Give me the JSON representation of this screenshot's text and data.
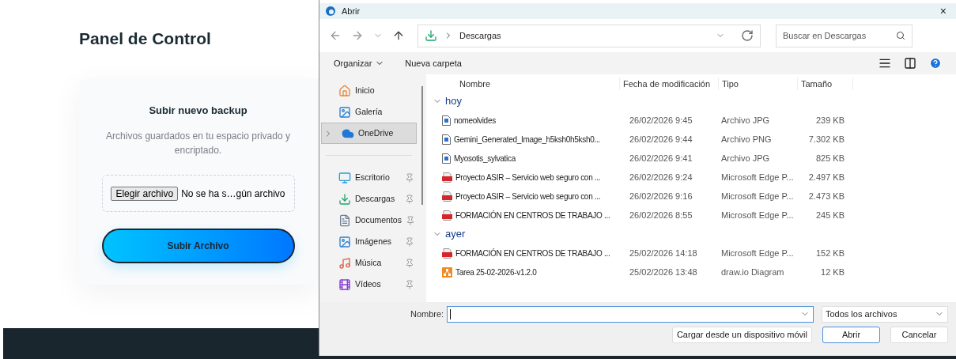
{
  "page": {
    "title": "Panel de Control",
    "card": {
      "heading": "Subir nuevo backup",
      "description": "Archivos guardados en tu espacio privado y encriptado.",
      "file_button": "Elegir archivo",
      "file_status": "No se ha s…gún archivo",
      "upload_button": "Subir Archivo"
    }
  },
  "dialog": {
    "title": "Abrir",
    "close": "×",
    "location": "Descargas",
    "search_placeholder": "Buscar en Descargas",
    "toolbar": {
      "organize": "Organizar",
      "new_folder": "Nueva carpeta"
    },
    "sidebar": [
      {
        "label": "Inicio",
        "kind": "home",
        "pinned": false,
        "selected": false
      },
      {
        "label": "Galería",
        "kind": "gallery",
        "pinned": false,
        "selected": false
      },
      {
        "label": "OneDrive",
        "kind": "cloud",
        "pinned": false,
        "selected": true
      },
      {
        "label": "Escritorio",
        "kind": "desktop",
        "pinned": true,
        "selected": false
      },
      {
        "label": "Descargas",
        "kind": "download",
        "pinned": true,
        "selected": false
      },
      {
        "label": "Documentos",
        "kind": "documents",
        "pinned": true,
        "selected": false
      },
      {
        "label": "Imágenes",
        "kind": "pictures",
        "pinned": true,
        "selected": false
      },
      {
        "label": "Música",
        "kind": "music",
        "pinned": true,
        "selected": false
      },
      {
        "label": "Vídeos",
        "kind": "videos",
        "pinned": true,
        "selected": false
      }
    ],
    "columns": [
      "Nombre",
      "Fecha de modificación",
      "Tipo",
      "Tamaño"
    ],
    "groups": [
      {
        "label": "hoy",
        "expanded": true,
        "files": [
          {
            "name": "nomeolvides",
            "date": "26/02/2026 9:45",
            "type": "Archivo JPG",
            "size": "239 KB",
            "kind": "image"
          },
          {
            "name": "Gemini_Generated_Image_h5ksh0h5ksh0...",
            "date": "26/02/2026 9:44",
            "type": "Archivo PNG",
            "size": "7.302 KB",
            "kind": "image"
          },
          {
            "name": "Myosotis_sylvatica",
            "date": "26/02/2026 9:41",
            "type": "Archivo JPG",
            "size": "825 KB",
            "kind": "image"
          },
          {
            "name": "Proyecto ASIR – Servicio web seguro con ...",
            "date": "26/02/2026 9:24",
            "type": "Microsoft Edge P...",
            "size": "2.497 KB",
            "kind": "pdf"
          },
          {
            "name": "Proyecto ASIR – Servicio web seguro con ...",
            "date": "26/02/2026 9:16",
            "type": "Microsoft Edge P...",
            "size": "2.473 KB",
            "kind": "pdf"
          },
          {
            "name": "FORMACIÓN EN CENTROS DE TRABAJO ...",
            "date": "26/02/2026 8:55",
            "type": "Microsoft Edge P...",
            "size": "245 KB",
            "kind": "pdf"
          }
        ]
      },
      {
        "label": "ayer",
        "expanded": true,
        "files": [
          {
            "name": "FORMACIÓN EN CENTROS DE TRABAJO ...",
            "date": "25/02/2026 14:18",
            "type": "Microsoft Edge P...",
            "size": "152 KB",
            "kind": "pdf"
          },
          {
            "name": "Tarea 25-02-2026-v1.2.0",
            "date": "25/02/2026 13:48",
            "type": "draw.io Diagram",
            "size": "12 KB",
            "kind": "diagram"
          }
        ]
      }
    ],
    "name_label": "Nombre:",
    "file_type": "Todos los archivos",
    "buttons": [
      {
        "label": "Cargar desde un dispositivo móvil",
        "kind": "secondary"
      },
      {
        "label": "Abrir",
        "kind": "primary"
      },
      {
        "label": "Cancelar",
        "kind": "secondary"
      }
    ]
  }
}
